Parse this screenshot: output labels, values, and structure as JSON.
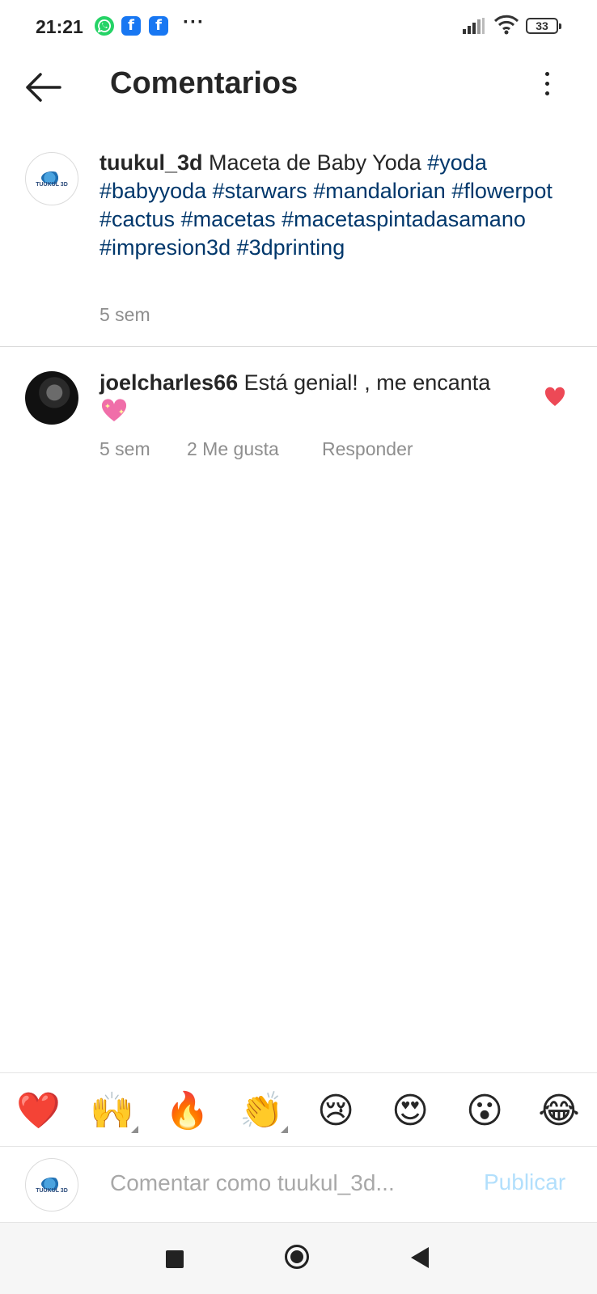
{
  "status_bar": {
    "time": "21:21",
    "notification_icons": [
      "whatsapp-icon",
      "facebook-icon",
      "facebook-icon"
    ],
    "more": "···",
    "battery": "33"
  },
  "header": {
    "title": "Comentarios",
    "back_icon": "back-arrow-icon",
    "more_icon": "more-vertical-icon"
  },
  "caption": {
    "username": "tuukul_3d",
    "text": "Maceta de Baby Yoda",
    "hashtags": [
      "#yoda",
      "#babyyoda",
      "#starwars",
      "#mandalorian",
      "#flowerpot",
      "#cactus",
      "#macetas",
      "#macetaspintadasamano",
      "#impresion3d",
      "#3dprinting"
    ],
    "time": "5 sem",
    "avatar_brand": "TUUKUL 3D"
  },
  "comments": [
    {
      "username": "joelcharles66",
      "text": "Está genial! , me encanta",
      "emoji": "sparkling-heart-icon",
      "time": "5 sem",
      "likes": "2 Me gusta",
      "reply": "Responder",
      "liked": true
    }
  ],
  "reactions": [
    "❤️",
    "🙌",
    "🔥",
    "👏",
    "😢",
    "😍",
    "😮",
    "😂"
  ],
  "composer": {
    "placeholder": "Comentar como tuukul_3d...",
    "publish": "Publicar"
  },
  "colors": {
    "hashtag": "#00376b",
    "meta": "#8e8e8e",
    "like_heart": "#ed4956",
    "publish_disabled": "#b2dffc"
  }
}
